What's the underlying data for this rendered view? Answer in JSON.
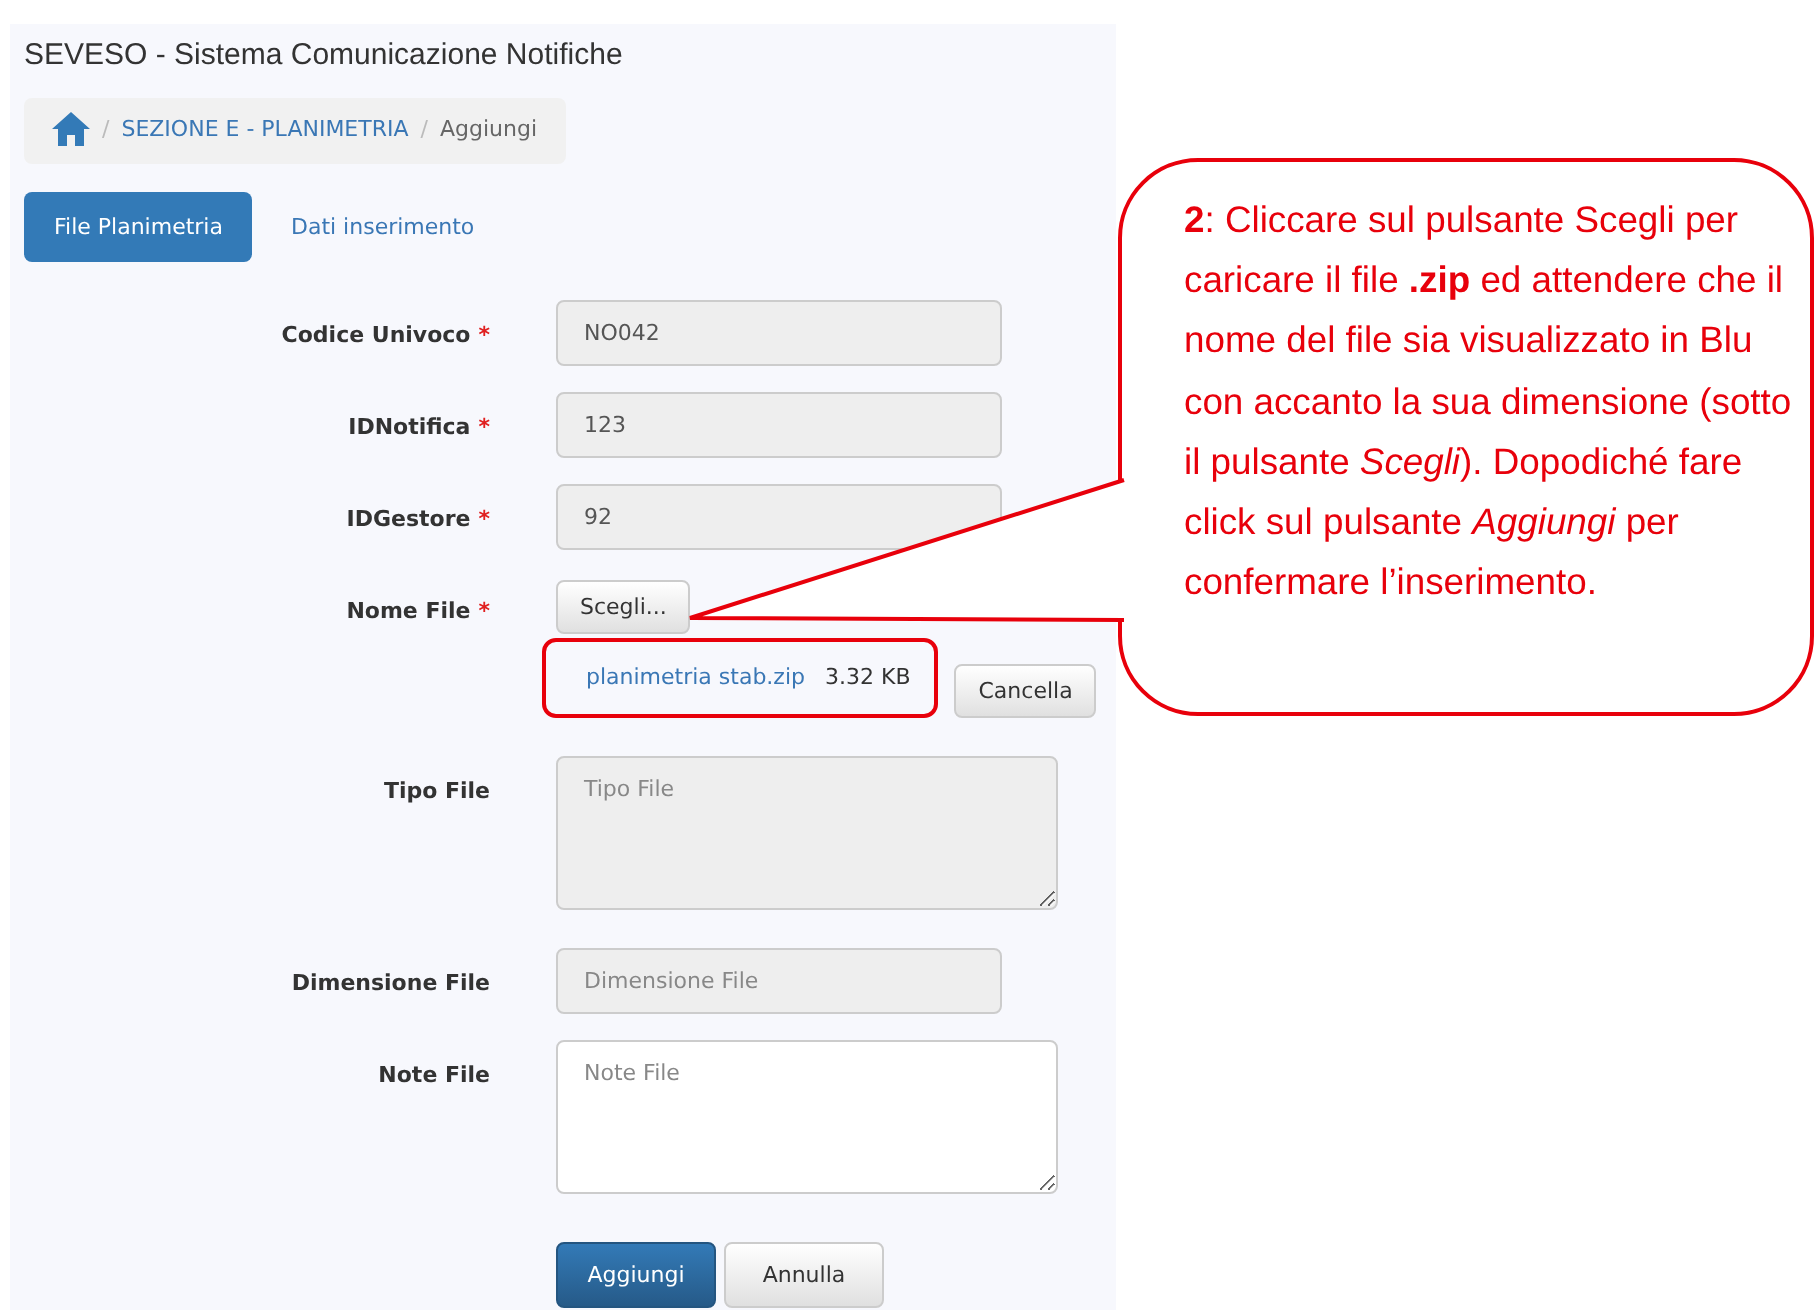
{
  "title": "SEVESO - Sistema Comunicazione Notifiche",
  "breadcrumb": [
    {
      "separator": "/",
      "label": "SEZIONE E - PLANIMETRIA",
      "kind": "link"
    },
    {
      "separator": "/",
      "label": "Aggiungi",
      "kind": "current"
    }
  ],
  "tabs": [
    {
      "label": "File Planimetria",
      "selected": true
    },
    {
      "label": "Dati inserimento",
      "selected": false
    }
  ],
  "fields": [
    {
      "kind": "input",
      "label": "Codice Univoco",
      "required_mark": "*",
      "value": "NO042",
      "disabled": true
    },
    {
      "kind": "input",
      "label": "IDNotifica",
      "required_mark": "*",
      "value": "123",
      "disabled": true
    },
    {
      "kind": "input",
      "label": "IDGestore",
      "required_mark": "*",
      "value": "92",
      "disabled": true
    },
    {
      "kind": "file",
      "label": "Nome File",
      "required_mark": "*",
      "button": "Scegli...",
      "file_name": "planimetria stab.zip",
      "file_size": "3.32 KB",
      "remove_button": "Cancella"
    },
    {
      "kind": "textarea",
      "label": "Tipo File",
      "placeholder": "Tipo File",
      "disabled": true
    },
    {
      "kind": "input",
      "label": "Dimensione File",
      "placeholder": "Dimensione File",
      "disabled": true
    },
    {
      "kind": "textarea",
      "label": "Note File",
      "placeholder": "Note File",
      "disabled": false
    }
  ],
  "buttons": [
    {
      "label": "Aggiungi",
      "kind": "primary"
    },
    {
      "label": "Annulla",
      "kind": "default"
    }
  ],
  "callout": {
    "text": "**2**: Cliccare sul pulsante Scegli per caricare il file **.zip** ed attendere che il nome del file sia visualizzato in Blu con accanto la sua dimensione (sotto il pulsante *Scegli*). Dopodiché fare click sul pulsante *Aggiungi* per confermare l’inserimento."
  }
}
